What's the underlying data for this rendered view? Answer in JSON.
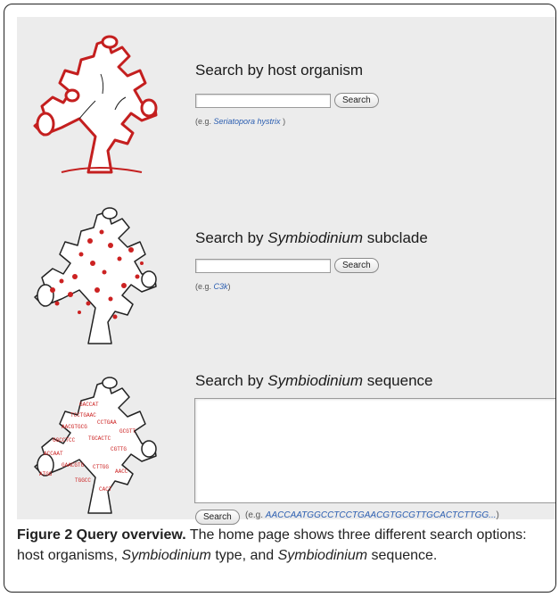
{
  "sections": [
    {
      "title_prefix": "Search by host organism",
      "title_italic": "",
      "title_suffix": "",
      "button_label": "Search",
      "example_prefix": "(e.g. ",
      "example_value": "Seriatopora hystrix",
      "example_suffix": " )",
      "coral_style": "outline-red"
    },
    {
      "title_prefix": "Search by ",
      "title_italic": "Symbiodinium",
      "title_suffix": " subclade",
      "button_label": "Search",
      "example_prefix": "(e.g. ",
      "example_value": "C3k",
      "example_suffix": ")",
      "coral_style": "red-dots"
    },
    {
      "title_prefix": "Search by ",
      "title_italic": "Symbiodinium",
      "title_suffix": " sequence",
      "button_label": "Search",
      "example_prefix": "(e.g. ",
      "example_value": "AACCAATGGCCTCCTGAACGTGCGTTGCACTCTTGG...",
      "example_suffix": ")",
      "coral_style": "red-sequence-text"
    }
  ],
  "caption": {
    "label": "Figure 2 Query overview.",
    "text_1": " The home page shows three different search options: host organisms, ",
    "italic_1": "Symbiodinium",
    "text_2": " type, and ",
    "italic_2": "Symbiodinium",
    "text_3": " sequence."
  },
  "colors": {
    "coral_red": "#cc2222",
    "link_blue": "#2a5db0",
    "panel_bg": "#ececec"
  }
}
